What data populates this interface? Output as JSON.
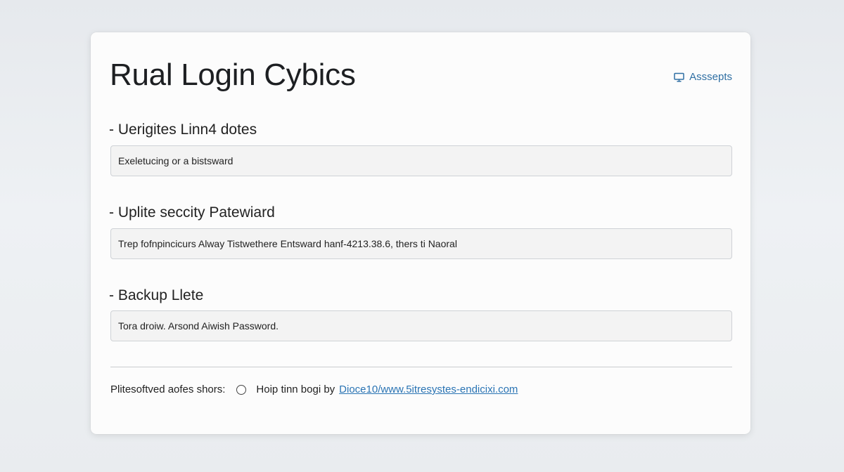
{
  "header": {
    "title": "Rual Login Cybics",
    "link_label": "Asssepts",
    "link_icon": "monitor-icon",
    "accent": "#2f6fa3"
  },
  "sections": [
    {
      "label": "- Uerigites Linn4 dotes",
      "value": "Exeletucing or a bistsward"
    },
    {
      "label": "- Uplite seccity Patewiard",
      "value": "Trep fofnpincicurs Alway Tistwethere Entsward hanf-4213.38.6, thers ti Naoral"
    },
    {
      "label": "- Backup Llete",
      "value": "Tora droiw. Arsond Aiwish Password."
    }
  ],
  "footer": {
    "prefix": "Plitesoftved aofes shors:",
    "radio_text": "Hoip tinn bogi by",
    "link": "Dioce10/www.5itresystes-endicixi.com",
    "link_color": "#2a74b4"
  }
}
